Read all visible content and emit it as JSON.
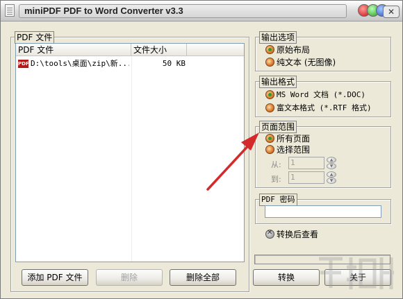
{
  "window": {
    "title": "miniPDF PDF to Word Converter v3.3",
    "close_glyph": "✕"
  },
  "file_group": {
    "label": "PDF 文件",
    "columns": [
      "PDF 文件",
      "文件大小"
    ],
    "rows": [
      {
        "icon": "PDF",
        "file": "D:\\tools\\桌面\\zip\\新...",
        "size": "50 KB"
      }
    ]
  },
  "buttons": {
    "add": "添加 PDF 文件",
    "delete": "删除",
    "delete_all": "删除全部",
    "convert": "转换",
    "close": "关于"
  },
  "output_options": {
    "label": "输出选项",
    "items": [
      "原始布局",
      "纯文本 (无图像)"
    ],
    "selected": 0
  },
  "output_format": {
    "label": "输出格式",
    "items": [
      "MS Word 文档 (*.DOC)",
      "富文本格式 (*.RTF 格式)"
    ],
    "selected": 0
  },
  "page_range": {
    "label": "页面范围",
    "items": [
      "所有页面",
      "选择范围"
    ],
    "selected": 0,
    "from_label": "从:",
    "from_value": "1",
    "to_label": "到:",
    "to_value": "1"
  },
  "password": {
    "label": "PDF 密码",
    "value": ""
  },
  "view_after": {
    "label": "转换后查看"
  },
  "colors": {
    "window_bg": "#ece9d8",
    "annotation_arrow": "#d42a2a"
  }
}
